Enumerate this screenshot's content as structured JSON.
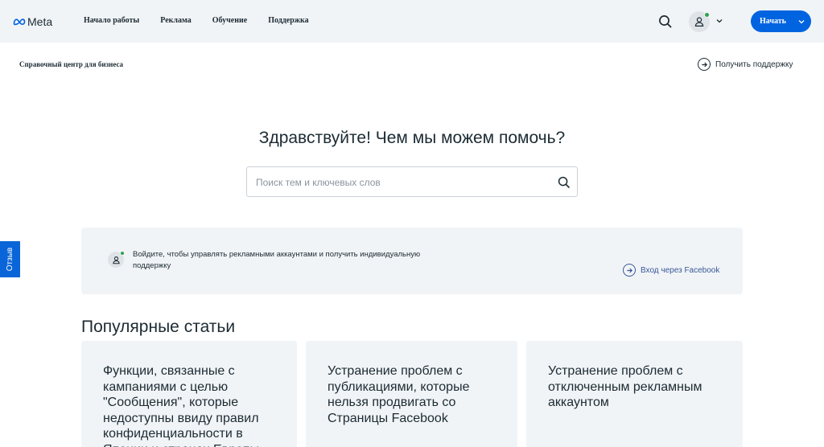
{
  "header": {
    "logo_text": "Meta",
    "nav": [
      "Начало работы",
      "Реклама",
      "Обучение",
      "Поддержка"
    ],
    "start_label": "Начать"
  },
  "subheader": {
    "title": "Справочный центр для бизнеса",
    "support_link": "Получить поддержку"
  },
  "hero": {
    "title": "Здравствуйте! Чем мы можем помочь?",
    "search_placeholder": "Поиск тем и ключевых слов",
    "search_value": ""
  },
  "feedback_tab": "Отзыв",
  "login_panel": {
    "text": "Войдите, чтобы управлять рекламными аккаунтами и получить индивидуальную поддержку",
    "link": "Вход через Facebook"
  },
  "popular": {
    "title": "Популярные статьи",
    "cards": [
      "Функции, связанные с кампаниями с целью \"Сообщения\", которые недоступны ввиду правил конфиденциальности в Японии и странах Европы",
      "Устранение проблем с публикациями, которые нельзя продвигать со Страницы Facebook",
      "Устранение проблем с отключенным рекламным аккаунтом"
    ]
  },
  "colors": {
    "topbar_bg": "#f1f4f7",
    "primary_button": "#0064e0",
    "text": "#1c2b33",
    "status_dot": "#31a24c",
    "feedback_tab": "#0a66d8",
    "link": "#385898"
  },
  "icons": [
    "meta-logo-icon",
    "search-icon",
    "user-icon",
    "chevron-down-icon",
    "arrow-right-icon"
  ]
}
